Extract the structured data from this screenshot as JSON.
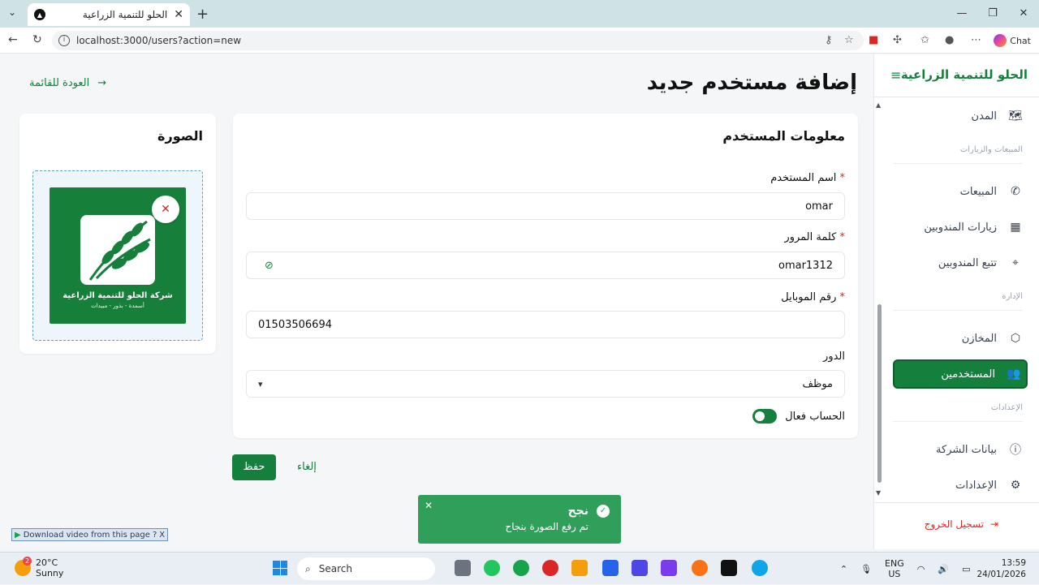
{
  "browser": {
    "tab_title": "الحلو للتنمية الزراعية",
    "url": "localhost:3000/users?action=new",
    "chat_label": "Chat"
  },
  "sidebar": {
    "brand": "الحلو للتنمية الزراعية",
    "items": [
      {
        "label": "المدن",
        "icon": "map-icon"
      },
      {
        "label": "المبيعات",
        "icon": "phone-icon"
      },
      {
        "label": "زيارات المندوبين",
        "icon": "calendar-icon"
      },
      {
        "label": "تتبع المندوبين",
        "icon": "location-pin-icon"
      },
      {
        "label": "المخازن",
        "icon": "box-icon"
      },
      {
        "label": "المستخدمين",
        "icon": "users-icon"
      },
      {
        "label": "بيانات الشركة",
        "icon": "info-icon"
      },
      {
        "label": "الإعدادات",
        "icon": "gear-icon"
      }
    ],
    "sections": [
      "المبيعات والزيارات",
      "الإدارة",
      "الإعدادات"
    ],
    "logout": "تسجيل الخروج"
  },
  "page": {
    "title": "إضافة مستخدم جديد",
    "back": "العودة للقائمة"
  },
  "form": {
    "title": "معلومات المستخدم",
    "username_label": "اسم المستخدم",
    "username_value": "omar",
    "password_label": "كلمة المرور",
    "password_value": "omar1312",
    "mobile_label": "رقم الموبايل",
    "mobile_value": "01503506694",
    "role_label": "الدور",
    "role_value": "موظف",
    "active_label": "الحساب فعال",
    "required_mark": "*",
    "active": true
  },
  "image_card": {
    "title": "الصورة",
    "logo_name": "شركة الحلو للتنمية الزراعية",
    "logo_sub": "أسمدة - بذور - مبيدات"
  },
  "actions": {
    "save": "حفظ",
    "cancel": "إلغاء"
  },
  "toast": {
    "title": "نجح",
    "message": "تم رفع الصورة بنجاح"
  },
  "download_bar": {
    "label": "Download video from this page",
    "help": "?",
    "close": "X"
  },
  "taskbar": {
    "temperature": "20°C",
    "weather": "Sunny",
    "weather_badge": "2",
    "search": "Search",
    "lang1": "ENG",
    "lang2": "US",
    "time": "13:59",
    "date": "24/01/2026"
  },
  "colors": {
    "primary": "#15803d",
    "toast": "#2f9f5a",
    "required": "#dc2626"
  }
}
